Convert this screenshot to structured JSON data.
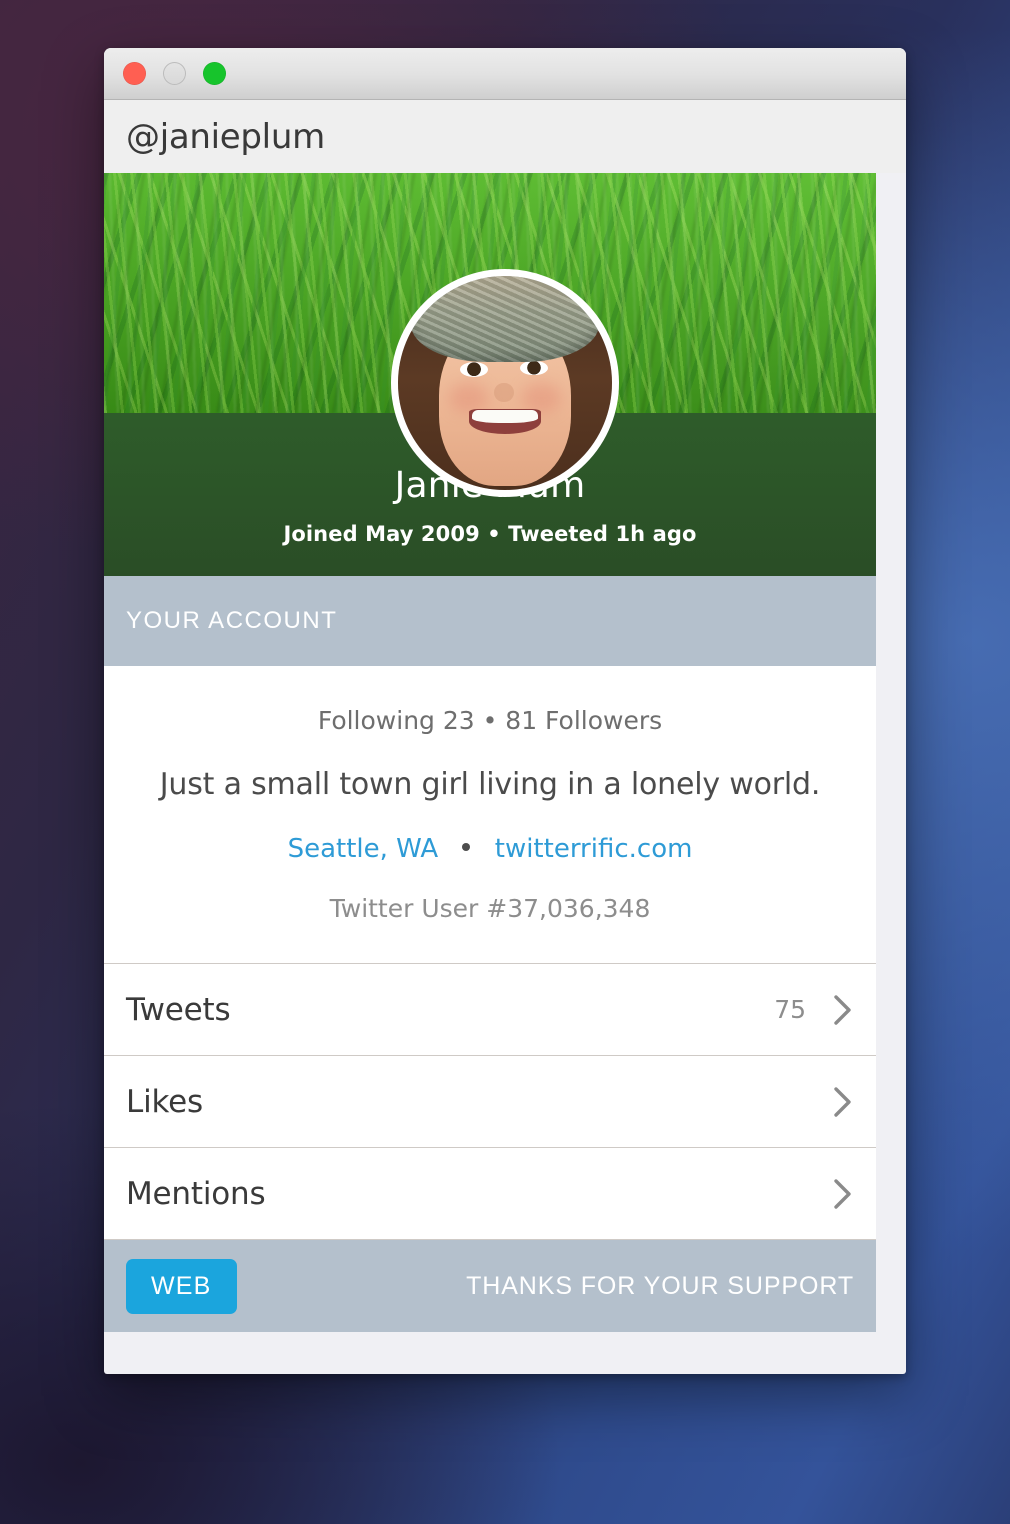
{
  "window": {
    "traffic_lights": [
      {
        "name": "close",
        "color": "#ff5f52"
      },
      {
        "name": "minimize",
        "color": "#dcdcdc"
      },
      {
        "name": "zoom",
        "color": "#17c42c"
      }
    ]
  },
  "header": {
    "handle": "@janieplum"
  },
  "profile": {
    "display_name": "Janie Plum",
    "meta": "Joined May 2009 • Tweeted 1h ago",
    "avatar_alt": "Janie Plum profile photo",
    "banner_alt": "green grass banner"
  },
  "section": {
    "title": "YOUR ACCOUNT"
  },
  "bio": {
    "stats": "Following 23 • 81 Followers",
    "description": "Just a small town girl living in a lonely world.",
    "location": "Seattle, WA",
    "website": "twitterrific.com",
    "user_id": "Twitter User #37,036,348"
  },
  "rows": [
    {
      "label": "Tweets",
      "count": "75"
    },
    {
      "label": "Likes",
      "count": ""
    },
    {
      "label": "Mentions",
      "count": ""
    }
  ],
  "footer": {
    "web_label": "WEB",
    "thanks": "THANKS FOR YOUR SUPPORT"
  },
  "colors": {
    "accent_blue": "#1ba5dd",
    "link_blue": "#2e9bd6",
    "section_bar": "#b4c0cc",
    "name_band": "#2c5428",
    "banner_green": "#48ad1c"
  }
}
